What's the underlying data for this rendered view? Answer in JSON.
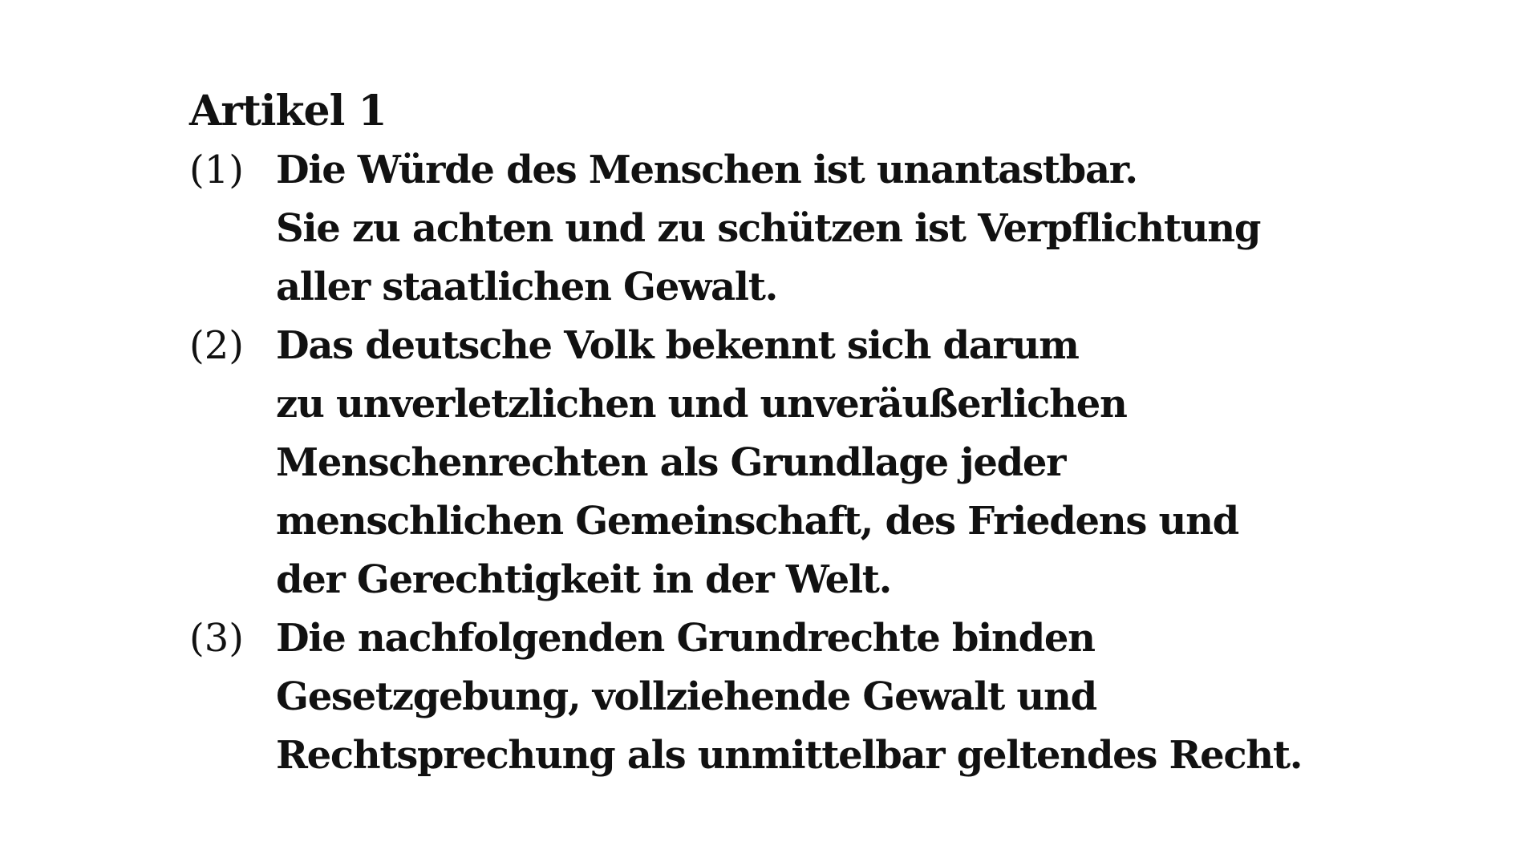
{
  "article": {
    "title": "Artikel 1",
    "paragraphs": [
      {
        "number": "(1)",
        "lines": [
          "Die Würde des Menschen ist unantastbar.",
          "Sie zu achten und zu schützen ist Verpflichtung",
          "aller staatlichen Gewalt."
        ]
      },
      {
        "number": "(2)",
        "lines": [
          "Das deutsche Volk bekennt sich darum",
          "zu unverletzlichen und unveräußerlichen",
          "Menschenrechten als Grundlage jeder",
          "menschlichen Gemeinschaft, des Friedens und",
          "der Gerechtigkeit in der Welt."
        ]
      },
      {
        "number": "(3)",
        "lines": [
          "Die nachfolgenden Grundrechte binden",
          "Gesetzgebung, vollziehende Gewalt und",
          "Rechtsprechung als unmittelbar geltendes Recht."
        ]
      }
    ]
  }
}
